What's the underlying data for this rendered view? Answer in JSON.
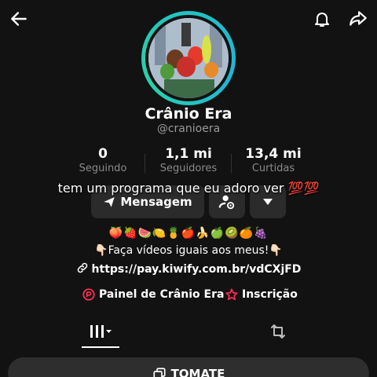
{
  "header": {
    "back_icon": "back-arrow-icon",
    "bell_icon": "bell-icon",
    "share_icon": "share-arrow-icon"
  },
  "profile": {
    "name": "Crânio Era",
    "handle": "@cranioera",
    "avatar_ring_color": "#22c1c3"
  },
  "stats": [
    {
      "value": "0",
      "label": "Seguindo"
    },
    {
      "value": "1,1 mi",
      "label": "Seguidores"
    },
    {
      "value": "13,4 mi",
      "label": "Curtidas"
    }
  ],
  "actions": {
    "message_label": "Mensagem",
    "message_icon": "paper-plane-icon",
    "friend_icon": "person-gear-icon",
    "dropdown_icon": "caret-down-icon"
  },
  "overlay": {
    "caption": "tem um programa que eu adoro ver 💯💯"
  },
  "bio": {
    "emojis": "🍑🍓🍉🍋🍍🍎🍌🍏🥝🍊🍇",
    "line": "👇🏻Faça vídeos iguais aos meus!👇🏻",
    "link": "https://pay.kiwify.com.br/vdCXjFD"
  },
  "links": {
    "panel_label": "Painel de Crânio Era",
    "subscription_label": "Inscrição",
    "accent_color": "#fe2c55"
  },
  "tabs": {
    "grid_icon": "grid-icon",
    "repost_icon": "repost-icon"
  },
  "bottom": {
    "label": "TOMATE",
    "icon": "copy-icon"
  }
}
